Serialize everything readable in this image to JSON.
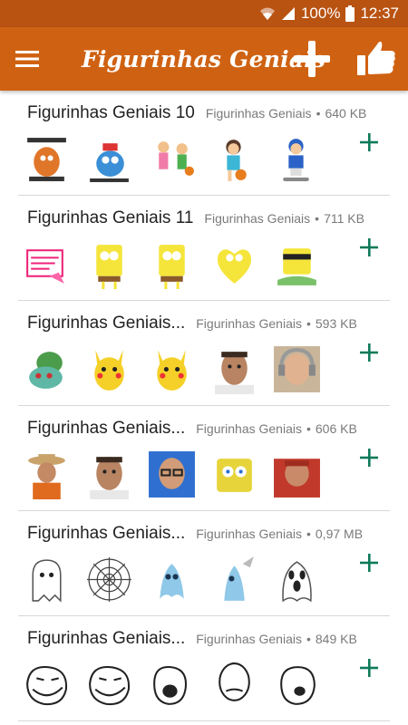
{
  "status": {
    "battery": "100%",
    "time": "12:37"
  },
  "app_bar": {
    "title": "Figurinhas Geniais"
  },
  "colors": {
    "app_bar": "#cf6212",
    "status_bar": "#b95312",
    "accent_plus": "#0f7a5a"
  },
  "packs": [
    {
      "name": "Figurinhas Geniais 10",
      "publisher": "Figurinhas Geniais",
      "size": "640 KB",
      "stickers": [
        "orange-monster-sticker",
        "blue-monster-sticker",
        "kids-basketball-sticker",
        "girl-ball-sticker",
        "boy-skateboard-sticker"
      ]
    },
    {
      "name": "Figurinhas Geniais 11",
      "publisher": "Figurinhas Geniais",
      "size": "711 KB",
      "stickers": [
        "note-sticker",
        "spongebob-sticker",
        "spongebob-sticker",
        "spongebob-heart-sticker",
        "spongebob-cool-sticker"
      ]
    },
    {
      "name": "Figurinhas Geniais...",
      "publisher": "Figurinhas Geniais",
      "size": "593 KB",
      "stickers": [
        "bulbasaur-sticker",
        "pikachu-sticker",
        "pikachu-sticker",
        "man-face-sticker",
        "man-headphones-sticker"
      ]
    },
    {
      "name": "Figurinhas Geniais...",
      "publisher": "Figurinhas Geniais",
      "size": "606 KB",
      "stickers": [
        "cowboy-sticker",
        "man-face-sticker",
        "glasses-man-sticker",
        "spongebob-face-sticker",
        "man-red-sticker"
      ]
    },
    {
      "name": "Figurinhas Geniais...",
      "publisher": "Figurinhas Geniais",
      "size": "0,97 MB",
      "stickers": [
        "ghost-sticker",
        "spiderweb-sticker",
        "blue-ghost-sticker",
        "blue-ghost-knife-sticker",
        "scream-ghost-sticker"
      ]
    },
    {
      "name": "Figurinhas Geniais...",
      "publisher": "Figurinhas Geniais",
      "size": "849 KB",
      "stickers": [
        "trollface-sticker",
        "trollface-sticker",
        "lol-face-sticker",
        "okay-face-sticker",
        "no-face-sticker"
      ]
    }
  ]
}
